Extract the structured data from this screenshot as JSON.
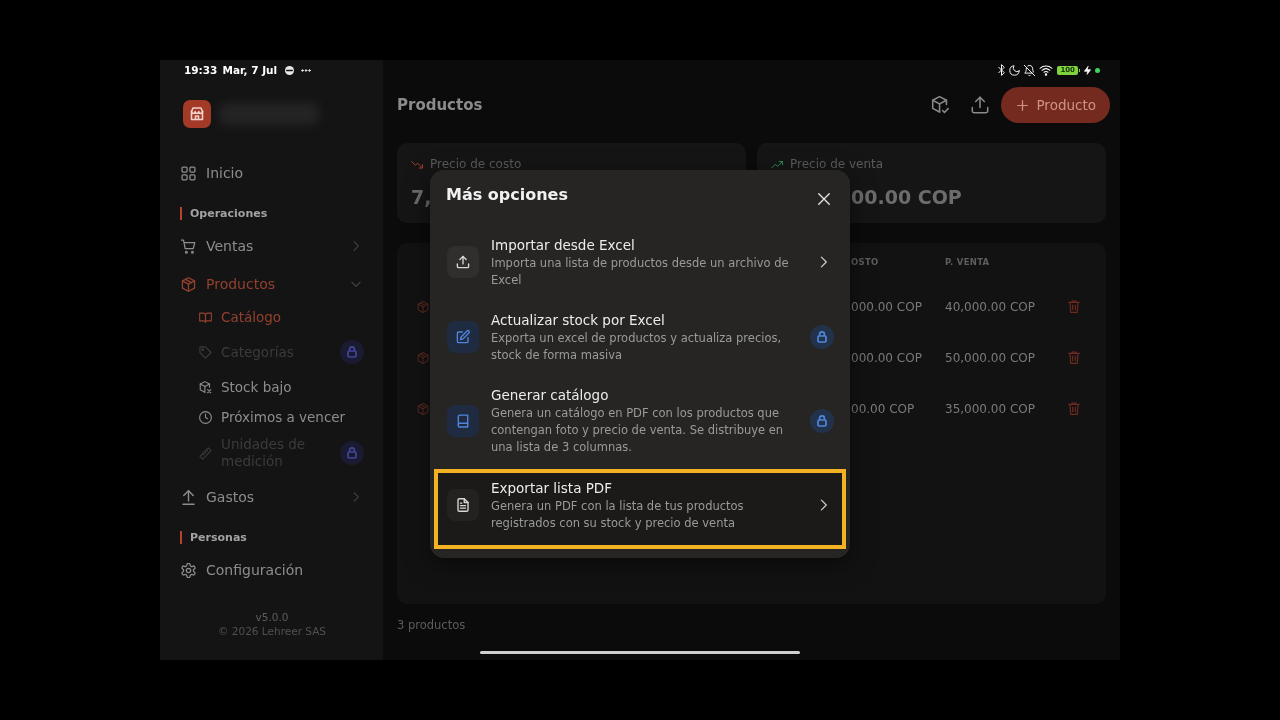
{
  "status_bar": {
    "time": "19:33",
    "date": "Mar, 7 Jul",
    "battery": "100"
  },
  "sidebar": {
    "items": [
      {
        "kind": "link",
        "label": "Inicio",
        "selected": false
      },
      {
        "kind": "section",
        "label": "Operaciones"
      },
      {
        "kind": "group",
        "label": "Ventas",
        "selected": false,
        "expanded": false
      },
      {
        "kind": "group",
        "label": "Productos",
        "selected": true,
        "expanded": true,
        "children": [
          {
            "label": "Catálogo",
            "selected": true,
            "locked": false
          },
          {
            "label": "Categorías",
            "selected": false,
            "locked": true
          },
          {
            "label": "Stock bajo",
            "selected": false,
            "locked": false
          },
          {
            "label": "Próximos a vencer",
            "selected": false,
            "locked": false
          },
          {
            "label": "Unidades de medición",
            "selected": false,
            "locked": true
          }
        ]
      },
      {
        "kind": "group",
        "label": "Gastos",
        "selected": false,
        "expanded": false
      },
      {
        "kind": "section",
        "label": "Personas"
      }
    ],
    "settings": {
      "label": "Configuración",
      "selected": false
    },
    "version": "v5.0.0",
    "copyright": "© 2026 Lehreer SAS"
  },
  "header": {
    "title": "Productos",
    "add_button": "Producto"
  },
  "stats": [
    {
      "label": "Precio de costo",
      "value": "7,",
      "kind": "down"
    },
    {
      "label": "Precio de venta",
      "value": "00.00 COP",
      "kind": "up"
    }
  ],
  "table": {
    "columns": [
      "OSTO",
      "P. VENTA"
    ],
    "rows": [
      {
        "cells": [
          "000.00 COP",
          "40,000.00 COP"
        ]
      },
      {
        "cells": [
          "000.00 COP",
          "50,000.00 COP"
        ]
      },
      {
        "cells": [
          "00.00 COP",
          "35,000.00 COP"
        ]
      }
    ]
  },
  "footer": "3 productos",
  "modal": {
    "title": "Más opciones",
    "items": [
      {
        "title": "Importar desde Excel",
        "description": "Importa una lista de productos desde un archivo de Excel",
        "locked": false,
        "highlighted": false
      },
      {
        "title": "Actualizar stock por Excel",
        "description": "Exporta un excel de productos y actualiza precios, stock de forma masiva",
        "locked": true,
        "highlighted": false
      },
      {
        "title": "Generar catálogo",
        "description": "Genera un catálogo en PDF con los productos que contengan foto y precio de venta. Se distribuye en una lista de 3 columnas.",
        "locked": true,
        "highlighted": false
      },
      {
        "title": "Exportar lista PDF",
        "description": "Genera un PDF con la lista de tus productos registrados con su stock y precio de venta",
        "locked": false,
        "highlighted": true
      }
    ]
  }
}
